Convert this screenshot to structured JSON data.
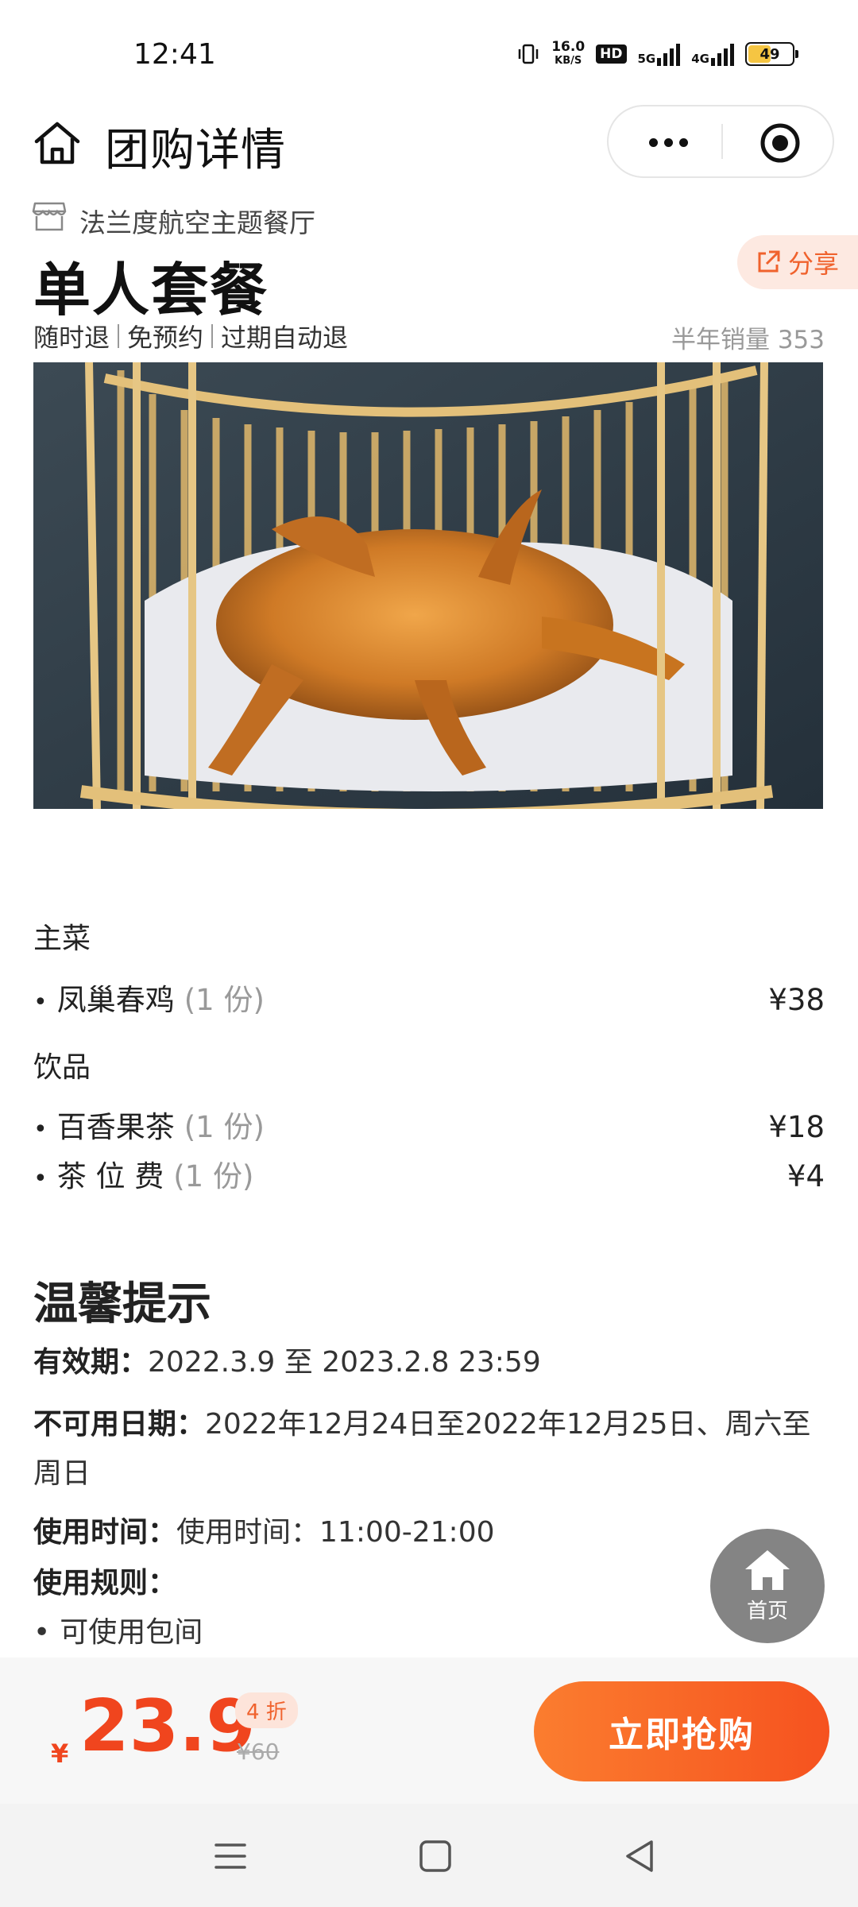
{
  "status_bar": {
    "time": "12:41",
    "net_speed_value": "16.0",
    "net_speed_unit": "KB/S",
    "hd_label": "HD",
    "net_5g": "5G",
    "net_4g": "4G",
    "battery": "49"
  },
  "header": {
    "title": "团购详情",
    "icons": {
      "home": "home-icon",
      "more": "more-icon",
      "target": "target-icon"
    }
  },
  "shop": {
    "name": "法兰度航空主题餐厅",
    "icon": "store-icon"
  },
  "share": {
    "label": "分享",
    "icon": "share-icon"
  },
  "deal": {
    "title": "单人套餐",
    "tags": [
      "随时退",
      "免预约",
      "过期自动退"
    ],
    "sales": "半年销量 353"
  },
  "menu": {
    "sections": [
      {
        "name": "主菜",
        "items": [
          {
            "bullet": "•",
            "name": "凤巢春鸡",
            "qty": "(1 份)",
            "price": "¥38"
          }
        ]
      },
      {
        "name": "饮品",
        "items": [
          {
            "bullet": "•",
            "name": "百香果茶",
            "qty": "(1 份)",
            "price": "¥18"
          },
          {
            "bullet": "•",
            "name": "茶 位 费",
            "qty": "(1 份)",
            "price": "¥4"
          }
        ]
      }
    ]
  },
  "tips": {
    "title": "温馨提示",
    "validity_label": "有效期：",
    "validity_value": "2022.3.9 至 2023.2.8 23:59",
    "unavailable_label": "不可用日期：",
    "unavailable_value_1": "2022年12月24日至2022年12月25日、周六至",
    "unavailable_value_2": "周日",
    "time_label": "使用时间：",
    "time_value": "使用时间：11:00-21:00",
    "rules_label": "使用规则：",
    "rule_bullet": "•",
    "rule_1": "可使用包间"
  },
  "float_home": {
    "label": "首页",
    "icon": "home-icon"
  },
  "purchase": {
    "currency": "¥",
    "price": "23.9",
    "discount": "4 折",
    "original_price": "¥60",
    "buy_label": "立即抢购"
  },
  "colors": {
    "accent": "#f0451e",
    "button_start": "#fb7d2f",
    "button_end": "#f6521f"
  }
}
